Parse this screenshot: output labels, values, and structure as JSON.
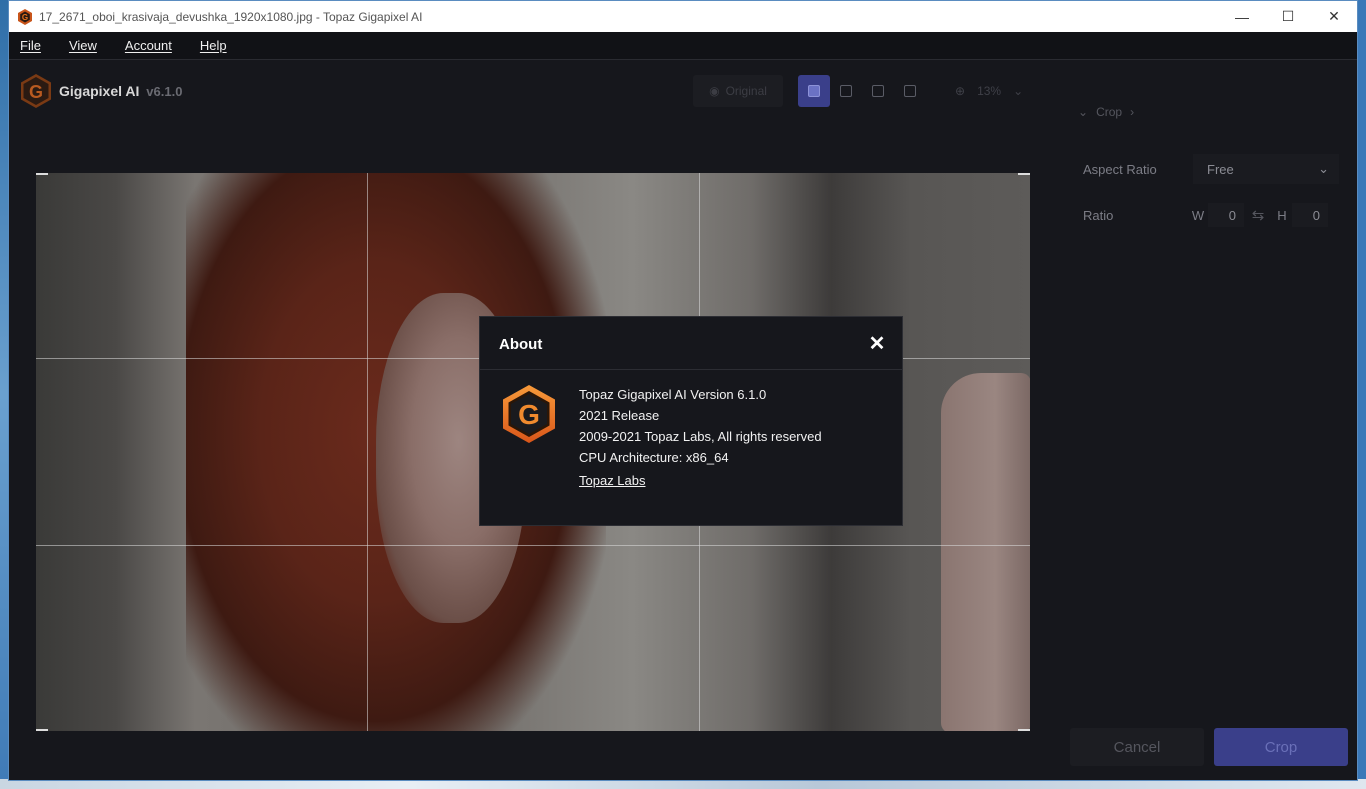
{
  "window": {
    "title": "17_2671_oboi_krasivaja_devushka_1920x1080.jpg - Topaz Gigapixel AI",
    "minimize_icon": "minimize-icon",
    "maximize_icon": "maximize-icon",
    "close_icon": "close-icon"
  },
  "menu": {
    "items": [
      "File",
      "View",
      "Account",
      "Help"
    ]
  },
  "app": {
    "name": "Gigapixel AI",
    "version": "v6.1.0"
  },
  "toolbar": {
    "original_label": "Original",
    "zoom_value": "13%"
  },
  "side_panel": {
    "section_title": "Crop",
    "aspect_ratio_label": "Aspect Ratio",
    "aspect_ratio_value": "Free",
    "ratio_label": "Ratio",
    "width_label": "W",
    "width_value": "0",
    "height_label": "H",
    "height_value": "0"
  },
  "buttons": {
    "cancel": "Cancel",
    "crop": "Crop"
  },
  "about_dialog": {
    "title": "About",
    "version_line": "Topaz Gigapixel AI Version 6.1.0",
    "release_line": "2021 Release",
    "copyright_line": "2009-2021 Topaz Labs, All rights reserved",
    "cpu_line": "CPU Architecture: x86_64",
    "link_text": "Topaz Labs"
  },
  "colors": {
    "accent": "#3a3f8a",
    "logo_orange": "#e8741e",
    "background": "#16171c"
  }
}
